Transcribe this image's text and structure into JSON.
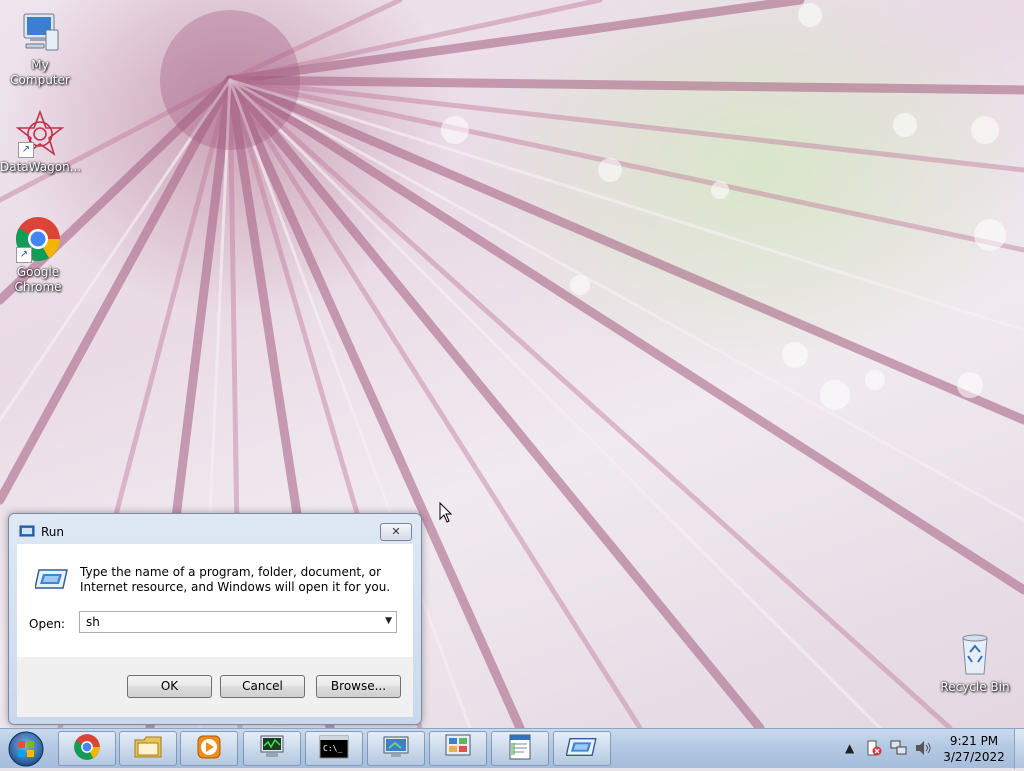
{
  "desktop": {
    "icons": [
      {
        "label": "My Computer",
        "icon": "computer-icon"
      },
      {
        "label": "DataWagon...",
        "icon": "datawagon-icon"
      },
      {
        "label": "Google Chrome",
        "icon": "chrome-icon"
      },
      {
        "label": "Recycle Bin",
        "icon": "recycle-bin-icon"
      }
    ]
  },
  "run_dialog": {
    "title": "Run",
    "description": "Type the name of a program, folder, document, or Internet resource, and Windows will open it for you.",
    "open_label": "Open:",
    "open_value": "sh",
    "ok_label": "OK",
    "cancel_label": "Cancel",
    "browse_label": "Browse...",
    "close_glyph": "✕"
  },
  "taskbar": {
    "pinned": [
      {
        "name": "chrome-taskbar-button",
        "icon": "chrome-icon"
      },
      {
        "name": "explorer-taskbar-button",
        "icon": "folder-icon"
      },
      {
        "name": "media-player-taskbar-button",
        "icon": "media-player-icon"
      },
      {
        "name": "task-manager-taskbar-button",
        "icon": "task-manager-icon"
      },
      {
        "name": "cmd-taskbar-button",
        "icon": "cmd-icon"
      },
      {
        "name": "remote-desktop-taskbar-button",
        "icon": "remote-desktop-icon"
      },
      {
        "name": "control-panel-taskbar-button",
        "icon": "control-panel-icon"
      },
      {
        "name": "notepad-taskbar-button",
        "icon": "document-icon"
      },
      {
        "name": "run-taskbar-button",
        "icon": "run-icon"
      }
    ],
    "clock": {
      "time": "9:21 PM",
      "date": "3/27/2022"
    }
  },
  "colors": {
    "taskbar": "#b4c9e3",
    "dialog_frame": "#c9d8ec",
    "text_white": "#ffffff"
  }
}
